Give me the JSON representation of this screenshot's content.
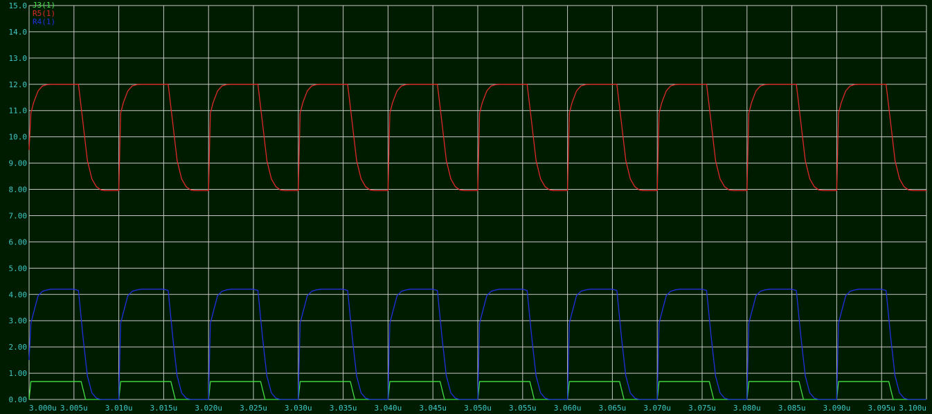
{
  "chart_data": {
    "type": "line",
    "title": "",
    "xlabel": "",
    "ylabel": "",
    "xlim": [
      3.0,
      3.1
    ],
    "ylim": [
      0,
      15
    ],
    "grid": true,
    "legend_position": "top-left",
    "colors": {
      "background": "#001c00",
      "grid": "#c8c8c8",
      "ticks": "#3fc8c8"
    },
    "x_ticks": [
      {
        "value": 3.0,
        "label": "3.000u"
      },
      {
        "value": 3.005,
        "label": "3.005u"
      },
      {
        "value": 3.01,
        "label": "3.010u"
      },
      {
        "value": 3.015,
        "label": "3.015u"
      },
      {
        "value": 3.02,
        "label": "3.020u"
      },
      {
        "value": 3.025,
        "label": "3.025u"
      },
      {
        "value": 3.03,
        "label": "3.030u"
      },
      {
        "value": 3.035,
        "label": "3.035u"
      },
      {
        "value": 3.04,
        "label": "3.040u"
      },
      {
        "value": 3.045,
        "label": "3.045u"
      },
      {
        "value": 3.05,
        "label": "3.050u"
      },
      {
        "value": 3.055,
        "label": "3.055u"
      },
      {
        "value": 3.06,
        "label": "3.060u"
      },
      {
        "value": 3.065,
        "label": "3.065u"
      },
      {
        "value": 3.07,
        "label": "3.070u"
      },
      {
        "value": 3.075,
        "label": "3.075u"
      },
      {
        "value": 3.08,
        "label": "3.080u"
      },
      {
        "value": 3.085,
        "label": "3.085u"
      },
      {
        "value": 3.09,
        "label": "3.090u"
      },
      {
        "value": 3.095,
        "label": "3.095u"
      },
      {
        "value": 3.1,
        "label": "3.100u"
      }
    ],
    "y_ticks": [
      {
        "value": 0,
        "label": "0.00"
      },
      {
        "value": 1,
        "label": "1.00"
      },
      {
        "value": 2,
        "label": "2.00"
      },
      {
        "value": 3,
        "label": "3.00"
      },
      {
        "value": 4,
        "label": "4.00"
      },
      {
        "value": 5,
        "label": "5.00"
      },
      {
        "value": 6,
        "label": "6.00"
      },
      {
        "value": 7,
        "label": "7.00"
      },
      {
        "value": 8,
        "label": "8.00"
      },
      {
        "value": 9,
        "label": "9.00"
      },
      {
        "value": 10,
        "label": "10.0"
      },
      {
        "value": 11,
        "label": "11.0"
      },
      {
        "value": 12,
        "label": "12.0"
      },
      {
        "value": 13,
        "label": "13.0"
      },
      {
        "value": 14,
        "label": "14.0"
      },
      {
        "value": 15,
        "label": "15.0"
      }
    ],
    "series": [
      {
        "name": "J3(1)",
        "color": "#44e044",
        "x": [
          3.0,
          3.0002,
          3.0058,
          3.0063,
          3.01,
          3.0102,
          3.0158,
          3.0163,
          3.02,
          3.0202,
          3.0258,
          3.0263,
          3.03,
          3.0302,
          3.0358,
          3.0363,
          3.04,
          3.0402,
          3.0458,
          3.0463,
          3.05,
          3.0502,
          3.0558,
          3.0563,
          3.06,
          3.0602,
          3.0658,
          3.0663,
          3.07,
          3.0702,
          3.0758,
          3.0763,
          3.08,
          3.0802,
          3.0858,
          3.0863,
          3.09,
          3.0902,
          3.0958,
          3.0963,
          3.1
        ],
        "y": [
          0,
          0.68,
          0.68,
          0,
          0,
          0.68,
          0.68,
          0,
          0,
          0.68,
          0.68,
          0,
          0,
          0.68,
          0.68,
          0,
          0,
          0.68,
          0.68,
          0,
          0,
          0.68,
          0.68,
          0,
          0,
          0.68,
          0.68,
          0,
          0,
          0.68,
          0.68,
          0,
          0,
          0.68,
          0.68,
          0,
          0,
          0.68,
          0.68,
          0,
          0
        ]
      },
      {
        "name": "R5(1)",
        "color": "#e02828",
        "x": [
          3.0,
          3.0002,
          3.0005,
          3.001,
          3.0015,
          3.002,
          3.0025,
          3.003,
          3.0035,
          3.004,
          3.0045,
          3.005,
          3.0055,
          3.006,
          3.0065,
          3.007,
          3.0075,
          3.008,
          3.0085,
          3.009,
          3.0095,
          3.01,
          3.0102,
          3.0105,
          3.011,
          3.0115,
          3.012,
          3.0125,
          3.013,
          3.0135,
          3.014,
          3.0145,
          3.015,
          3.0155,
          3.016,
          3.0165,
          3.017,
          3.0175,
          3.018,
          3.0185,
          3.019,
          3.0195,
          3.02,
          3.0202,
          3.0205,
          3.021,
          3.0215,
          3.022,
          3.0225,
          3.023,
          3.0235,
          3.024,
          3.0245,
          3.025,
          3.0255,
          3.026,
          3.0265,
          3.027,
          3.0275,
          3.028,
          3.0285,
          3.029,
          3.0295,
          3.03,
          3.0302,
          3.0305,
          3.031,
          3.0315,
          3.032,
          3.0325,
          3.033,
          3.0335,
          3.034,
          3.0345,
          3.035,
          3.0355,
          3.036,
          3.0365,
          3.037,
          3.0375,
          3.038,
          3.0385,
          3.039,
          3.0395,
          3.04,
          3.0402,
          3.0405,
          3.041,
          3.0415,
          3.042,
          3.0425,
          3.043,
          3.0435,
          3.044,
          3.0445,
          3.045,
          3.0455,
          3.046,
          3.0465,
          3.047,
          3.0475,
          3.048,
          3.0485,
          3.049,
          3.0495,
          3.05,
          3.0502,
          3.0505,
          3.051,
          3.0515,
          3.052,
          3.0525,
          3.053,
          3.0535,
          3.054,
          3.0545,
          3.055,
          3.0555,
          3.056,
          3.0565,
          3.057,
          3.0575,
          3.058,
          3.0585,
          3.059,
          3.0595,
          3.06,
          3.0602,
          3.0605,
          3.061,
          3.0615,
          3.062,
          3.0625,
          3.063,
          3.0635,
          3.064,
          3.0645,
          3.065,
          3.0655,
          3.066,
          3.0665,
          3.067,
          3.0675,
          3.068,
          3.0685,
          3.069,
          3.0695,
          3.07,
          3.0702,
          3.0705,
          3.071,
          3.0715,
          3.072,
          3.0725,
          3.073,
          3.0735,
          3.074,
          3.0745,
          3.075,
          3.0755,
          3.076,
          3.0765,
          3.077,
          3.0775,
          3.078,
          3.0785,
          3.079,
          3.0795,
          3.08,
          3.0802,
          3.0805,
          3.081,
          3.0815,
          3.082,
          3.0825,
          3.083,
          3.0835,
          3.084,
          3.0845,
          3.085,
          3.0855,
          3.086,
          3.0865,
          3.087,
          3.0875,
          3.088,
          3.0885,
          3.089,
          3.0895,
          3.09,
          3.0902,
          3.0905,
          3.091,
          3.0915,
          3.092,
          3.0925,
          3.093,
          3.0935,
          3.094,
          3.0945,
          3.095,
          3.0955,
          3.096,
          3.0965,
          3.097,
          3.0975,
          3.098,
          3.0985,
          3.099,
          3.0995,
          3.1
        ],
        "y": [
          9.5,
          10.9,
          11.3,
          11.75,
          11.94,
          11.99,
          12.0,
          12.0,
          12.0,
          12.0,
          12.0,
          12.0,
          12.0,
          10.55,
          9.1,
          8.4,
          8.1,
          7.98,
          7.95,
          7.95,
          7.95,
          7.95,
          10.9,
          11.3,
          11.75,
          11.94,
          11.99,
          12.0,
          12.0,
          12.0,
          12.0,
          12.0,
          12.0,
          12.0,
          10.55,
          9.1,
          8.4,
          8.1,
          7.98,
          7.95,
          7.95,
          7.95,
          7.95,
          10.9,
          11.3,
          11.75,
          11.94,
          11.99,
          12.0,
          12.0,
          12.0,
          12.0,
          12.0,
          12.0,
          12.0,
          10.55,
          9.1,
          8.4,
          8.1,
          7.98,
          7.95,
          7.95,
          7.95,
          7.95,
          10.9,
          11.3,
          11.75,
          11.94,
          11.99,
          12.0,
          12.0,
          12.0,
          12.0,
          12.0,
          12.0,
          12.0,
          10.55,
          9.1,
          8.4,
          8.1,
          7.98,
          7.95,
          7.95,
          7.95,
          7.95,
          10.9,
          11.3,
          11.75,
          11.94,
          11.99,
          12.0,
          12.0,
          12.0,
          12.0,
          12.0,
          12.0,
          12.0,
          10.55,
          9.1,
          8.4,
          8.1,
          7.98,
          7.95,
          7.95,
          7.95,
          7.95,
          10.9,
          11.3,
          11.75,
          11.94,
          11.99,
          12.0,
          12.0,
          12.0,
          12.0,
          12.0,
          12.0,
          12.0,
          10.55,
          9.1,
          8.4,
          8.1,
          7.98,
          7.95,
          7.95,
          7.95,
          7.95,
          10.9,
          11.3,
          11.75,
          11.94,
          11.99,
          12.0,
          12.0,
          12.0,
          12.0,
          12.0,
          12.0,
          12.0,
          10.55,
          9.1,
          8.4,
          8.1,
          7.98,
          7.95,
          7.95,
          7.95,
          7.95,
          10.9,
          11.3,
          11.75,
          11.94,
          11.99,
          12.0,
          12.0,
          12.0,
          12.0,
          12.0,
          12.0,
          12.0,
          10.55,
          9.1,
          8.4,
          8.1,
          7.98,
          7.95,
          7.95,
          7.95,
          7.95,
          10.9,
          11.3,
          11.75,
          11.94,
          11.99,
          12.0,
          12.0,
          12.0,
          12.0,
          12.0,
          12.0,
          12.0,
          10.55,
          9.1,
          8.4,
          8.1,
          7.98,
          7.95,
          7.95,
          7.95,
          7.95,
          10.9,
          11.3,
          11.75,
          11.94,
          11.99,
          12.0,
          12.0,
          12.0,
          12.0,
          12.0,
          12.0,
          12.0,
          10.55,
          9.1,
          8.4,
          8.1,
          7.98,
          7.95,
          7.95,
          7.95,
          7.95
        ]
      },
      {
        "name": "R4(1)",
        "color": "#2030e0",
        "x": [
          3.0,
          3.0002,
          3.0005,
          3.001,
          3.0015,
          3.002,
          3.0025,
          3.003,
          3.0035,
          3.004,
          3.0045,
          3.005,
          3.0055,
          3.006,
          3.0065,
          3.007,
          3.0075,
          3.008,
          3.0085,
          3.009,
          3.0095,
          3.01,
          3.0102,
          3.0105,
          3.011,
          3.0115,
          3.012,
          3.0125,
          3.013,
          3.0135,
          3.014,
          3.0145,
          3.015,
          3.0155,
          3.016,
          3.0165,
          3.017,
          3.0175,
          3.018,
          3.0185,
          3.019,
          3.0195,
          3.02,
          3.0202,
          3.0205,
          3.021,
          3.0215,
          3.022,
          3.0225,
          3.023,
          3.0235,
          3.024,
          3.0245,
          3.025,
          3.0255,
          3.026,
          3.0265,
          3.027,
          3.0275,
          3.028,
          3.0285,
          3.029,
          3.0295,
          3.03,
          3.0302,
          3.0305,
          3.031,
          3.0315,
          3.032,
          3.0325,
          3.033,
          3.0335,
          3.034,
          3.0345,
          3.035,
          3.0355,
          3.036,
          3.0365,
          3.037,
          3.0375,
          3.038,
          3.0385,
          3.039,
          3.0395,
          3.04,
          3.0402,
          3.0405,
          3.041,
          3.0415,
          3.042,
          3.0425,
          3.043,
          3.0435,
          3.044,
          3.0445,
          3.045,
          3.0455,
          3.046,
          3.0465,
          3.047,
          3.0475,
          3.048,
          3.0485,
          3.049,
          3.0495,
          3.05,
          3.0502,
          3.0505,
          3.051,
          3.0515,
          3.052,
          3.0525,
          3.053,
          3.0535,
          3.054,
          3.0545,
          3.055,
          3.0555,
          3.056,
          3.0565,
          3.057,
          3.0575,
          3.058,
          3.0585,
          3.059,
          3.0595,
          3.06,
          3.0602,
          3.0605,
          3.061,
          3.0615,
          3.062,
          3.0625,
          3.063,
          3.0635,
          3.064,
          3.0645,
          3.065,
          3.0655,
          3.066,
          3.0665,
          3.067,
          3.0675,
          3.068,
          3.0685,
          3.069,
          3.0695,
          3.07,
          3.0702,
          3.0705,
          3.071,
          3.0715,
          3.072,
          3.0725,
          3.073,
          3.0735,
          3.074,
          3.0745,
          3.075,
          3.0755,
          3.076,
          3.0765,
          3.077,
          3.0775,
          3.078,
          3.0785,
          3.079,
          3.0795,
          3.08,
          3.0802,
          3.0805,
          3.081,
          3.0815,
          3.082,
          3.0825,
          3.083,
          3.0835,
          3.084,
          3.0845,
          3.085,
          3.0855,
          3.086,
          3.0865,
          3.087,
          3.0875,
          3.088,
          3.0885,
          3.089,
          3.0895,
          3.09,
          3.0902,
          3.0905,
          3.091,
          3.0915,
          3.092,
          3.0925,
          3.093,
          3.0935,
          3.094,
          3.0945,
          3.095,
          3.0955,
          3.096,
          3.0965,
          3.097,
          3.0975,
          3.098,
          3.0985,
          3.099,
          3.0995,
          3.1
        ],
        "y": [
          1.5,
          2.9,
          3.3,
          3.95,
          4.12,
          4.17,
          4.2,
          4.2,
          4.2,
          4.2,
          4.2,
          4.2,
          4.15,
          2.4,
          0.9,
          0.25,
          0.05,
          0.0,
          0.0,
          0.0,
          0.0,
          0.0,
          2.9,
          3.3,
          3.95,
          4.12,
          4.17,
          4.2,
          4.2,
          4.2,
          4.2,
          4.2,
          4.2,
          4.15,
          2.4,
          0.9,
          0.25,
          0.05,
          0.0,
          0.0,
          0.0,
          0.0,
          0.0,
          2.9,
          3.3,
          3.95,
          4.12,
          4.17,
          4.2,
          4.2,
          4.2,
          4.2,
          4.2,
          4.2,
          4.15,
          2.4,
          0.9,
          0.25,
          0.05,
          0.0,
          0.0,
          0.0,
          0.0,
          0.0,
          2.9,
          3.3,
          3.95,
          4.12,
          4.17,
          4.2,
          4.2,
          4.2,
          4.2,
          4.2,
          4.2,
          4.15,
          2.4,
          0.9,
          0.25,
          0.05,
          0.0,
          0.0,
          0.0,
          0.0,
          0.0,
          2.9,
          3.3,
          3.95,
          4.12,
          4.17,
          4.2,
          4.2,
          4.2,
          4.2,
          4.2,
          4.2,
          4.15,
          2.4,
          0.9,
          0.25,
          0.05,
          0.0,
          0.0,
          0.0,
          0.0,
          0.0,
          2.9,
          3.3,
          3.95,
          4.12,
          4.17,
          4.2,
          4.2,
          4.2,
          4.2,
          4.2,
          4.2,
          4.15,
          2.4,
          0.9,
          0.25,
          0.05,
          0.0,
          0.0,
          0.0,
          0.0,
          0.0,
          2.9,
          3.3,
          3.95,
          4.12,
          4.17,
          4.2,
          4.2,
          4.2,
          4.2,
          4.2,
          4.2,
          4.15,
          2.4,
          0.9,
          0.25,
          0.05,
          0.0,
          0.0,
          0.0,
          0.0,
          0.0,
          2.9,
          3.3,
          3.95,
          4.12,
          4.17,
          4.2,
          4.2,
          4.2,
          4.2,
          4.2,
          4.2,
          4.15,
          2.4,
          0.9,
          0.25,
          0.05,
          0.0,
          0.0,
          0.0,
          0.0,
          0.0,
          2.9,
          3.3,
          3.95,
          4.12,
          4.17,
          4.2,
          4.2,
          4.2,
          4.2,
          4.2,
          4.2,
          4.15,
          2.4,
          0.9,
          0.25,
          0.05,
          0.0,
          0.0,
          0.0,
          0.0,
          0.0,
          2.9,
          3.3,
          3.95,
          4.12,
          4.17,
          4.2,
          4.2,
          4.2,
          4.2,
          4.2,
          4.2,
          4.15,
          2.4,
          0.9,
          0.25,
          0.05,
          0.0,
          0.0,
          0.0,
          0.0,
          0.0
        ]
      }
    ]
  }
}
